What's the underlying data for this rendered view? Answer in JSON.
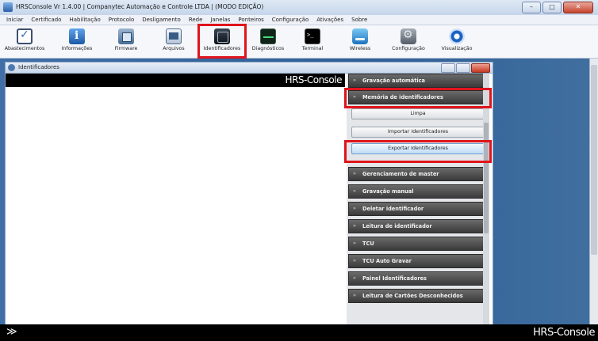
{
  "window": {
    "title": "HRSConsole Vr 1.4.00  |  Companytec Automação e Controle LTDA | (MODO EDIÇÃO)",
    "minimize": "–",
    "maximize": "□",
    "close": "✕"
  },
  "menu": [
    "Iniciar",
    "Certificado",
    "Habilitação",
    "Protocolo",
    "Desligamento",
    "Rede",
    "Janelas",
    "Ponteiros",
    "Configuração",
    "Ativações",
    "Sobre"
  ],
  "toolbar": [
    {
      "label": "Abastecimentos",
      "icon": "checkbox-icon"
    },
    {
      "label": "Informações",
      "icon": "info-icon"
    },
    {
      "label": "Firmware",
      "icon": "chip-icon"
    },
    {
      "label": "Arquivos",
      "icon": "folder-icon"
    },
    {
      "label": "Identificadores",
      "icon": "id-badge-icon"
    },
    {
      "label": "Diagnósticos",
      "icon": "diagnostics-icon"
    },
    {
      "label": "Terminal",
      "icon": "terminal-icon"
    },
    {
      "label": "Wireless",
      "icon": "wireless-icon"
    },
    {
      "label": "Configuração",
      "icon": "gear-icon"
    },
    {
      "label": "Visualização",
      "icon": "view-icon"
    }
  ],
  "child_window": {
    "title": "Identificadores",
    "brand": "HRS-Console"
  },
  "panel": {
    "sections": [
      "Gravação automática",
      "Memória de identificadores",
      "Gerenciamento de master",
      "Gravação manual",
      "Deletar identificador",
      "Leitura de identificador",
      "TCU",
      "TCU Auto Gravar",
      "Painel Identificadores",
      "Leitura de Cartões Desconhecidos"
    ],
    "buttons": [
      "Limpa",
      "Importar Identificadores",
      "Exportar Identificadores"
    ]
  },
  "statusbar": {
    "chevron": "≫",
    "brand": "HRS-Console"
  },
  "colors": {
    "highlight": "#e0141c",
    "workspace": "#2f5f98"
  }
}
